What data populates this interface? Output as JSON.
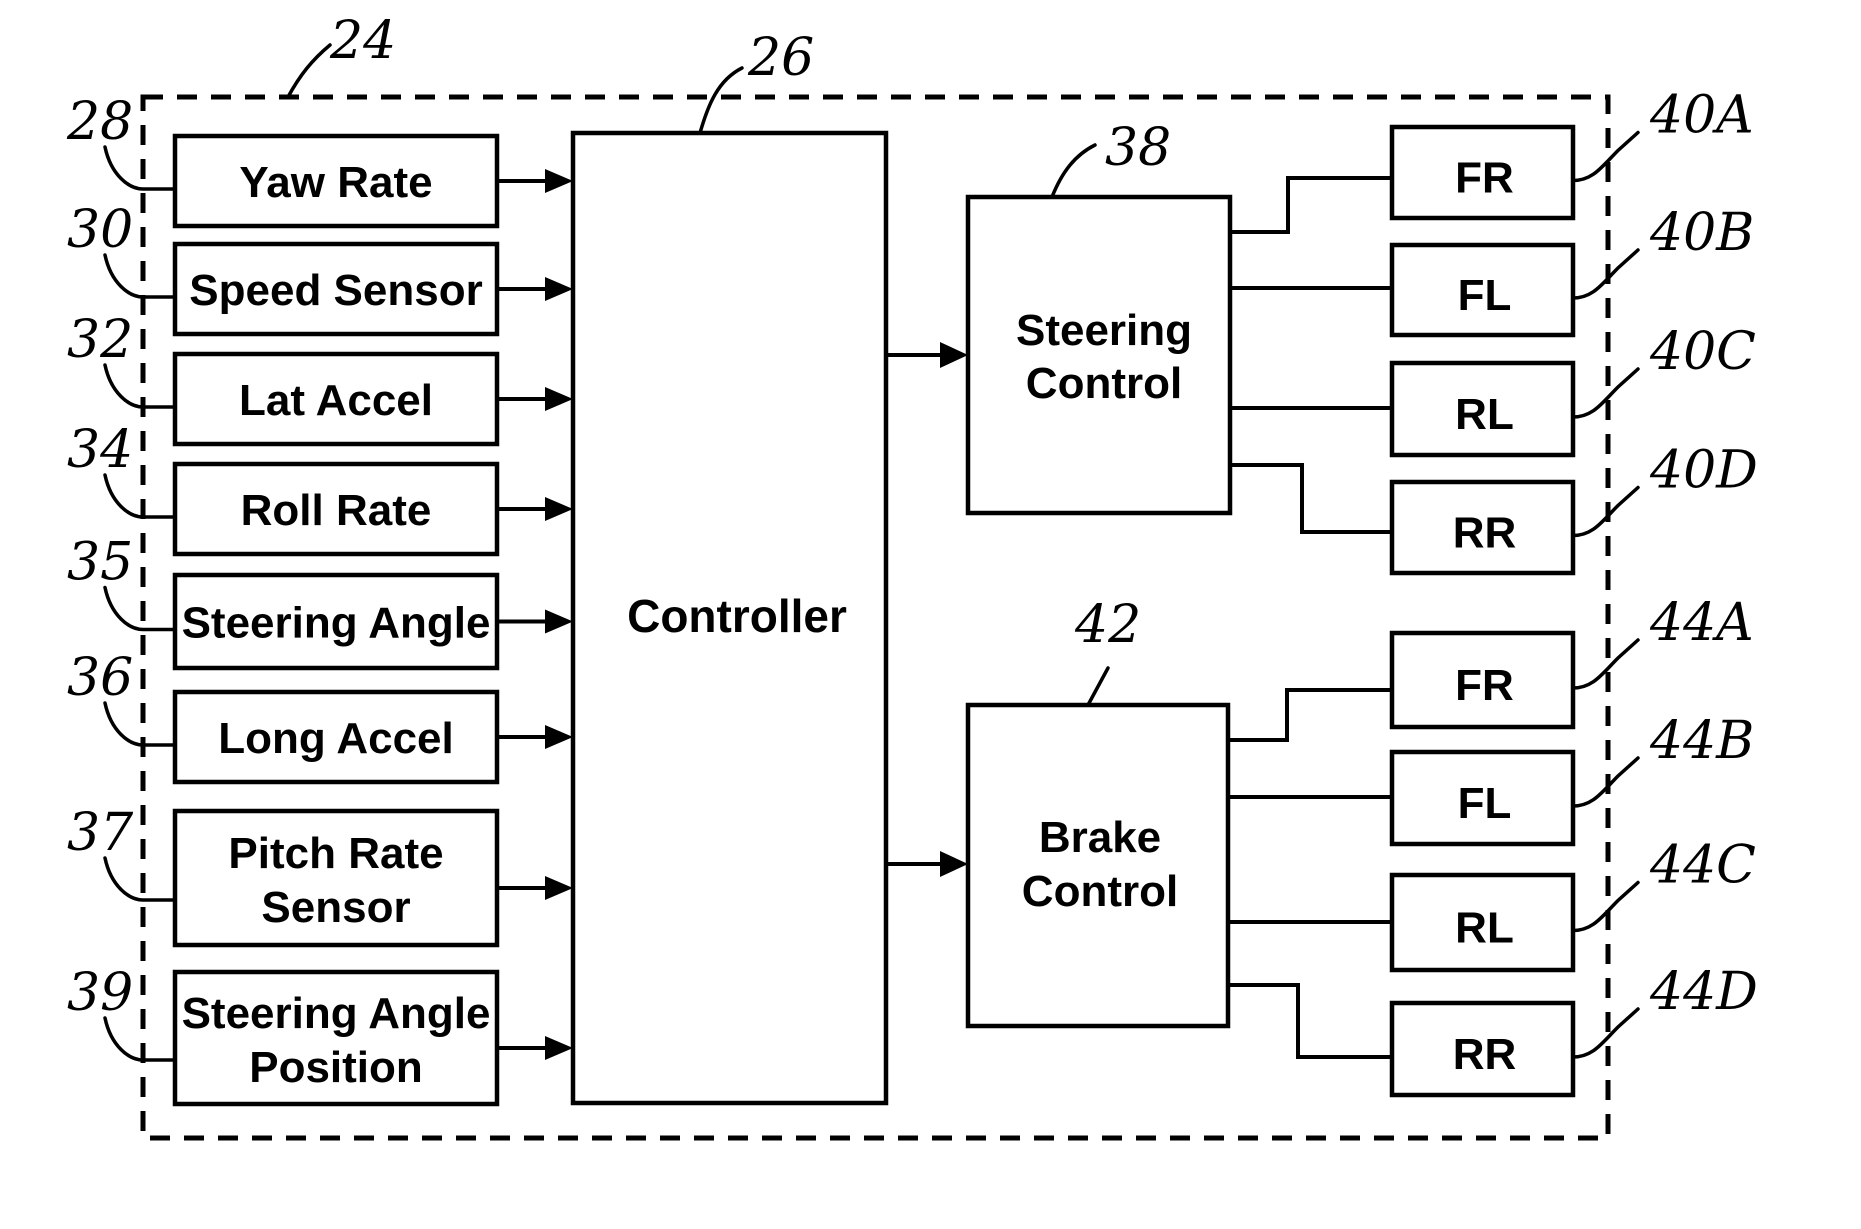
{
  "figure": {
    "system_ref": "24",
    "controller": {
      "ref": "26",
      "label": "Controller"
    },
    "sensors": [
      {
        "ref": "28",
        "lines": [
          "Yaw Rate"
        ]
      },
      {
        "ref": "30",
        "lines": [
          "Speed Sensor"
        ]
      },
      {
        "ref": "32",
        "lines": [
          "Lat Accel"
        ]
      },
      {
        "ref": "34",
        "lines": [
          "Roll Rate"
        ]
      },
      {
        "ref": "35",
        "lines": [
          "Steering Angle"
        ]
      },
      {
        "ref": "36",
        "lines": [
          "Long Accel"
        ]
      },
      {
        "ref": "37",
        "lines": [
          "Pitch Rate",
          "Sensor"
        ]
      },
      {
        "ref": "39",
        "lines": [
          "Steering Angle",
          "Position"
        ]
      }
    ],
    "steering_control": {
      "ref": "38",
      "lines": [
        "Steering",
        "Control"
      ],
      "actuators": [
        {
          "ref": "40A",
          "label": "FR"
        },
        {
          "ref": "40B",
          "label": "FL"
        },
        {
          "ref": "40C",
          "label": "RL"
        },
        {
          "ref": "40D",
          "label": "RR"
        }
      ]
    },
    "brake_control": {
      "ref": "42",
      "lines": [
        "Brake",
        "Control"
      ],
      "actuators": [
        {
          "ref": "44A",
          "label": "FR"
        },
        {
          "ref": "44B",
          "label": "FL"
        },
        {
          "ref": "44C",
          "label": "RL"
        },
        {
          "ref": "44D",
          "label": "RR"
        }
      ]
    }
  }
}
